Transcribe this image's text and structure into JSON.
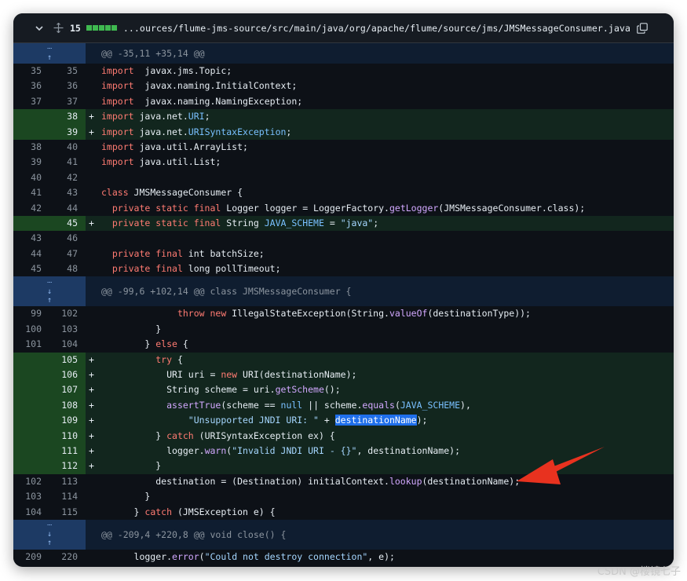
{
  "file": {
    "change_count": "15",
    "path": "...ources/flume-jms-source/src/main/java/org/apache/flume/source/jms/JMSMessageConsumer.java"
  },
  "hunks": [
    "@@ -35,11 +35,14 @@",
    "@@ -99,6 +102,14 @@ class JMSMessageConsumer {",
    "@@ -209,4 +220,8 @@ void close() {"
  ],
  "lines": [
    {
      "o": "35",
      "n": "35",
      "t": "ctx",
      "s": "",
      "tokens": [
        [
          "kw",
          "import"
        ],
        [
          "",
          "  javax.jms.Topic;"
        ]
      ]
    },
    {
      "o": "36",
      "n": "36",
      "t": "ctx",
      "s": "",
      "tokens": [
        [
          "kw",
          "import"
        ],
        [
          "",
          "  javax.naming.InitialContext;"
        ]
      ]
    },
    {
      "o": "37",
      "n": "37",
      "t": "ctx",
      "s": "",
      "tokens": [
        [
          "kw",
          "import"
        ],
        [
          "",
          "  javax.naming.NamingException;"
        ]
      ]
    },
    {
      "o": "",
      "n": "38",
      "t": "add",
      "s": "+",
      "tokens": [
        [
          "kw",
          "import"
        ],
        [
          "",
          " java.net."
        ],
        [
          "cst",
          "URI"
        ],
        [
          "",
          ";"
        ]
      ]
    },
    {
      "o": "",
      "n": "39",
      "t": "add",
      "s": "+",
      "tokens": [
        [
          "kw",
          "import"
        ],
        [
          "",
          " java.net."
        ],
        [
          "cst",
          "URISyntaxException"
        ],
        [
          "",
          ";"
        ]
      ]
    },
    {
      "o": "38",
      "n": "40",
      "t": "ctx",
      "s": "",
      "tokens": [
        [
          "kw",
          "import"
        ],
        [
          "",
          " java.util.ArrayList;"
        ]
      ]
    },
    {
      "o": "39",
      "n": "41",
      "t": "ctx",
      "s": "",
      "tokens": [
        [
          "kw",
          "import"
        ],
        [
          "",
          " java.util.List;"
        ]
      ]
    },
    {
      "o": "40",
      "n": "42",
      "t": "ctx",
      "s": "",
      "tokens": [
        [
          "",
          ""
        ]
      ]
    },
    {
      "o": "41",
      "n": "43",
      "t": "ctx",
      "s": "",
      "tokens": [
        [
          "kw",
          "class"
        ],
        [
          "",
          " JMSMessageConsumer {"
        ]
      ]
    },
    {
      "o": "42",
      "n": "44",
      "t": "ctx",
      "s": "",
      "tokens": [
        [
          "",
          "  "
        ],
        [
          "kw",
          "private static final"
        ],
        [
          "",
          " Logger logger = LoggerFactory."
        ],
        [
          "fn",
          "getLogger"
        ],
        [
          "",
          "(JMSMessageConsumer.class);"
        ]
      ]
    },
    {
      "o": "",
      "n": "45",
      "t": "add",
      "s": "+",
      "tokens": [
        [
          "",
          "  "
        ],
        [
          "kw",
          "private static final"
        ],
        [
          "",
          " String "
        ],
        [
          "cst",
          "JAVA_SCHEME"
        ],
        [
          "",
          " = "
        ],
        [
          "str",
          "\"java\""
        ],
        [
          "",
          ";"
        ]
      ]
    },
    {
      "o": "43",
      "n": "46",
      "t": "ctx",
      "s": "",
      "tokens": [
        [
          "",
          ""
        ]
      ]
    },
    {
      "o": "44",
      "n": "47",
      "t": "ctx",
      "s": "",
      "tokens": [
        [
          "",
          "  "
        ],
        [
          "kw",
          "private final"
        ],
        [
          "",
          " int batchSize;"
        ]
      ]
    },
    {
      "o": "45",
      "n": "48",
      "t": "ctx",
      "s": "",
      "tokens": [
        [
          "",
          "  "
        ],
        [
          "kw",
          "private final"
        ],
        [
          "",
          " long pollTimeout;"
        ]
      ]
    },
    {
      "hunk": 1
    },
    {
      "o": "99",
      "n": "102",
      "t": "ctx",
      "s": "",
      "tokens": [
        [
          "",
          "              "
        ],
        [
          "kw",
          "throw new"
        ],
        [
          "",
          " IllegalStateException(String."
        ],
        [
          "fn",
          "valueOf"
        ],
        [
          "",
          "(destinationType));"
        ]
      ]
    },
    {
      "o": "100",
      "n": "103",
      "t": "ctx",
      "s": "",
      "tokens": [
        [
          "",
          "          }"
        ]
      ]
    },
    {
      "o": "101",
      "n": "104",
      "t": "ctx",
      "s": "",
      "tokens": [
        [
          "",
          "        } "
        ],
        [
          "kw",
          "else"
        ],
        [
          "",
          " {"
        ]
      ]
    },
    {
      "o": "",
      "n": "105",
      "t": "add",
      "s": "+",
      "tokens": [
        [
          "",
          "          "
        ],
        [
          "kw",
          "try"
        ],
        [
          "",
          " {"
        ]
      ]
    },
    {
      "o": "",
      "n": "106",
      "t": "add",
      "s": "+",
      "tokens": [
        [
          "",
          "            URI uri = "
        ],
        [
          "kw",
          "new"
        ],
        [
          "",
          " URI(destinationName);"
        ]
      ]
    },
    {
      "o": "",
      "n": "107",
      "t": "add",
      "s": "+",
      "tokens": [
        [
          "",
          "            String scheme = uri."
        ],
        [
          "fn",
          "getScheme"
        ],
        [
          "",
          "();"
        ]
      ]
    },
    {
      "o": "",
      "n": "108",
      "t": "add",
      "s": "+",
      "tokens": [
        [
          "",
          "            "
        ],
        [
          "fn",
          "assertTrue"
        ],
        [
          "",
          "(scheme == "
        ],
        [
          "cst",
          "null"
        ],
        [
          "",
          " || scheme."
        ],
        [
          "fn",
          "equals"
        ],
        [
          "",
          "("
        ],
        [
          "cst",
          "JAVA_SCHEME"
        ],
        [
          "",
          "),"
        ]
      ]
    },
    {
      "o": "",
      "n": "109",
      "t": "add",
      "s": "+",
      "tokens": [
        [
          "",
          "                "
        ],
        [
          "str",
          "\"Unsupported JNDI URI: \""
        ],
        [
          "",
          " + "
        ],
        [
          "sel",
          "destinationName"
        ],
        [
          "",
          ");"
        ]
      ]
    },
    {
      "o": "",
      "n": "110",
      "t": "add",
      "s": "+",
      "tokens": [
        [
          "",
          "          } "
        ],
        [
          "kw",
          "catch"
        ],
        [
          "",
          " (URISyntaxException ex) {"
        ]
      ]
    },
    {
      "o": "",
      "n": "111",
      "t": "add",
      "s": "+",
      "tokens": [
        [
          "",
          "            logger."
        ],
        [
          "fn",
          "warn"
        ],
        [
          "",
          "("
        ],
        [
          "str",
          "\"Invalid JNDI URI - {}\""
        ],
        [
          "",
          ", destinationName);"
        ]
      ]
    },
    {
      "o": "",
      "n": "112",
      "t": "add",
      "s": "+",
      "tokens": [
        [
          "",
          "          }"
        ]
      ]
    },
    {
      "o": "102",
      "n": "113",
      "t": "ctx",
      "s": "",
      "tokens": [
        [
          "",
          "          destination = (Destination) initialContext."
        ],
        [
          "fn",
          "lookup"
        ],
        [
          "",
          "(destinationName);"
        ]
      ]
    },
    {
      "o": "103",
      "n": "114",
      "t": "ctx",
      "s": "",
      "tokens": [
        [
          "",
          "        }"
        ]
      ]
    },
    {
      "o": "104",
      "n": "115",
      "t": "ctx",
      "s": "",
      "tokens": [
        [
          "",
          "      } "
        ],
        [
          "kw",
          "catch"
        ],
        [
          "",
          " (JMSException e) {"
        ]
      ]
    },
    {
      "hunk": 2
    },
    {
      "o": "209",
      "n": "220",
      "t": "ctx",
      "s": "",
      "tokens": [
        [
          "",
          "      logger."
        ],
        [
          "fn",
          "error"
        ],
        [
          "",
          "("
        ],
        [
          "str",
          "\"Could not destroy connection\""
        ],
        [
          "",
          ", e);"
        ]
      ]
    }
  ],
  "watermark": "CSDN @楼镜七子",
  "colors": {
    "added_bar": "#3fb950",
    "arrow": "#e8321f"
  }
}
